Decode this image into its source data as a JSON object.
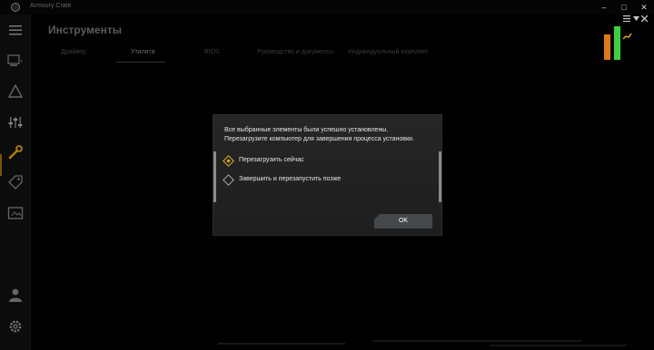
{
  "window": {
    "title": "Armoury Crate",
    "minimize": "–",
    "maximize": "□",
    "close": "✕"
  },
  "page": {
    "title": "Инструменты"
  },
  "tabs": [
    {
      "label": "Драйвер",
      "active": false
    },
    {
      "label": "Утилита",
      "active": true
    },
    {
      "label": "BIOS",
      "active": false
    },
    {
      "label": "Руководство и документы",
      "active": false
    },
    {
      "label": "Индивидуальный комплект",
      "active": false
    }
  ],
  "dialog": {
    "line1": "Все выбранные элементы были успешно установлены.",
    "line2": "Перезагрузите компьютер для завершения процесса установки.",
    "options": [
      {
        "label": "Перезагрузить сейчас",
        "checked": true
      },
      {
        "label": "Завершить и перезапустить позже",
        "checked": false
      }
    ],
    "ok_label": "OK"
  },
  "colors": {
    "accent": "#e8b31b",
    "bar_orange": "#e07a10",
    "bar_green": "#39d33d"
  },
  "icons": [
    "menu-icon",
    "device-icon",
    "aura-icon",
    "sliders-icon",
    "tools-icon",
    "tag-icon",
    "media-icon",
    "user-icon",
    "settings-icon"
  ]
}
